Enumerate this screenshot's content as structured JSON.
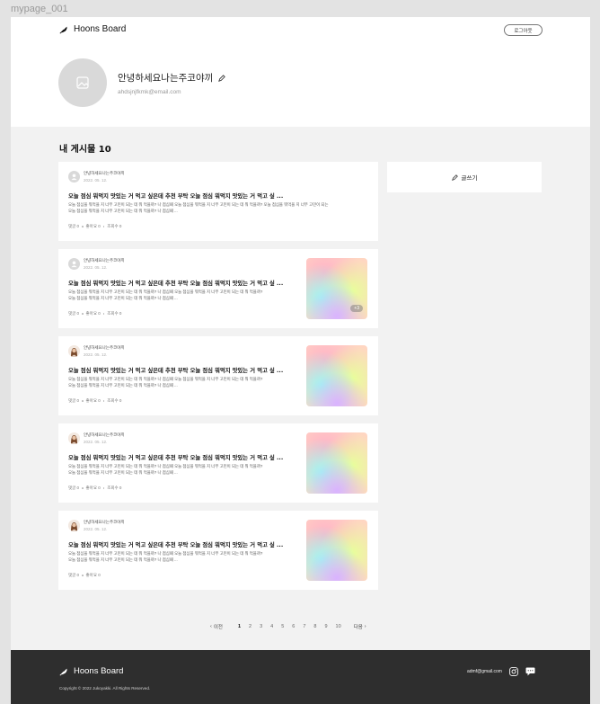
{
  "frame_label": "mypage_001",
  "header": {
    "logo_text": "Hoons Board",
    "logout_label": "로그아웃"
  },
  "profile": {
    "username": "안녕하세요나는주코야끼",
    "email": "ahdsjnjfkmk@email.com"
  },
  "section": {
    "title": "내 게시물 10"
  },
  "write_button": {
    "label": "글쓰기"
  },
  "posts": [
    {
      "author": "안녕하세요나는주코야끼",
      "date": "2022. 05. 12.",
      "title": "오늘 점심 뭐먹지 맛있는 거 먹고 싶은데 추천 부탁 오늘 점심 뭐먹지 맛있는 거 먹고 싶 ...",
      "body_line1": "오늘 점심을 뭐먹을 지 너무 고민이 되는 데 뭐 먹을까? 나 점심때 오늘 점심을 뭐먹을 지 너무 고민이 되는 데 뭐 먹을까? 오늘 점심을 뭐먹을 지 너무 고민이 되는",
      "body_line2": "오늘 점심을 뭐먹을 지 너무 고민이 되는 데 뭐 먹을까? 나 점심때 ...",
      "comments": "댓글 0",
      "likes": "좋아요 0",
      "views": "조회수 0",
      "avatar": "placeholder"
    },
    {
      "author": "안녕하세요나는주코야끼",
      "date": "2022. 05. 12.",
      "title": "오늘 점심 뭐먹지 맛있는 거 먹고 싶은데 추천 부탁 오늘 점심 뭐먹지 맛있는 거 먹고 싶 ...",
      "body_line1": "오늘 점심을 뭐먹을 지 너무 고민이 되는 데 뭐 먹을까? 나 점심때 오늘 점심을 뭐먹을 지 너무 고민이 되는 데 뭐 먹을까?",
      "body_line2": "오늘 점심을 뭐먹을 지 너무 고민이 되는 데 뭐 먹을까? 나 점심때 ...",
      "comments": "댓글 0",
      "likes": "좋아요 0",
      "views": "조회수 0",
      "avatar": "placeholder",
      "thumb_badge": "+3"
    },
    {
      "author": "안녕하세요나는주코야끼",
      "date": "2022. 05. 12.",
      "title": "오늘 점심 뭐먹지 맛있는 거 먹고 싶은데 추천 부탁 오늘 점심 뭐먹지 맛있는 거 먹고 싶 ...",
      "body_line1": "오늘 점심을 뭐먹을 지 너무 고민이 되는 데 뭐 먹을까? 나 점심때 오늘 점심을 뭐먹을 지 너무 고민이 되는 데 뭐 먹을까?",
      "body_line2": "오늘 점심을 뭐먹을 지 너무 고민이 되는 데 뭐 먹을까? 나 점심때 ...",
      "comments": "댓글 0",
      "likes": "좋아요 0",
      "views": "조회수 0",
      "avatar": "photo"
    },
    {
      "author": "안녕하세요나는주코야끼",
      "date": "2022. 05. 12.",
      "title": "오늘 점심 뭐먹지 맛있는 거 먹고 싶은데 추천 부탁 오늘 점심 뭐먹지 맛있는 거 먹고 싶 ...",
      "body_line1": "오늘 점심을 뭐먹을 지 너무 고민이 되는 데 뭐 먹을까? 나 점심때 오늘 점심을 뭐먹을 지 너무 고민이 되는 데 뭐 먹을까?",
      "body_line2": "오늘 점심을 뭐먹을 지 너무 고민이 되는 데 뭐 먹을까? 나 점심때 ...",
      "comments": "댓글 0",
      "likes": "좋아요 0",
      "views": "조회수 0",
      "avatar": "photo"
    },
    {
      "author": "안녕하세요나는주코야끼",
      "date": "2022. 05. 12.",
      "title": "오늘 점심 뭐먹지 맛있는 거 먹고 싶은데 추천 부탁 오늘 점심 뭐먹지 맛있는 거 먹고 싶 ...",
      "body_line1": "오늘 점심을 뭐먹을 지 너무 고민이 되는 데 뭐 먹을까? 나 점심때 오늘 점심을 뭐먹을 지 너무 고민이 되는 데 뭐 먹을까?",
      "body_line2": "오늘 점심을 뭐먹을 지 너무 고민이 되는 데 뭐 먹을까? 나 점심때 ...",
      "comments": "댓글 0",
      "likes": "좋아요 0",
      "avatar": "photo"
    }
  ],
  "pagination": {
    "prev": "이전",
    "next": "다음",
    "pages": [
      "1",
      "2",
      "3",
      "4",
      "5",
      "6",
      "7",
      "8",
      "9",
      "10"
    ],
    "current": "1"
  },
  "footer": {
    "logo_text": "Hoons Board",
    "copyright": "Copyright © 2022 Jukoyakki. All Rights Reserved.",
    "email": "admf@gmail.com"
  },
  "colors": {
    "page_bg": "#f2f2f2",
    "card_bg": "#ffffff",
    "footer_bg": "#2e2e2e",
    "avatar_placeholder": "#d9d9d9"
  },
  "icons": {
    "logo": "feather-icon",
    "edit": "pencil-icon",
    "profile_placeholder": "image-icon",
    "footer_social": [
      "instagram-icon",
      "chat-icon"
    ]
  }
}
